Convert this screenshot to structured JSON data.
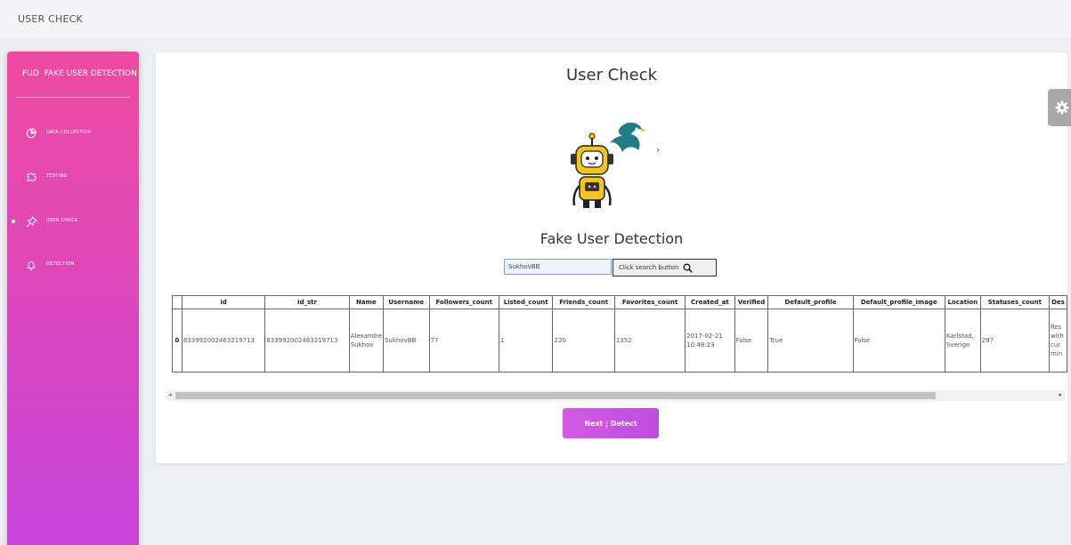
{
  "app": {
    "title": "USER CHECK"
  },
  "sidebar": {
    "brand_abbr": "FUD",
    "brand_name": "FAKE USER DETECTION",
    "items": [
      {
        "label": "DATA COLLECTION",
        "icon": "pie-chart-icon",
        "active": false
      },
      {
        "label": "TESTING",
        "icon": "puzzle-icon",
        "active": false
      },
      {
        "label": "USER CHECK",
        "icon": "pin-icon",
        "active": true
      },
      {
        "label": "DETECTION",
        "icon": "bell-icon",
        "active": false
      }
    ]
  },
  "main": {
    "title": "User Check",
    "subtitle": "Fake User Detection",
    "search": {
      "value": "SukhovBB",
      "button_label": "Click search button"
    },
    "next_button": "Next | Detect"
  },
  "table": {
    "columns": [
      "",
      "id",
      "id_str",
      "Name",
      "Username",
      "Followers_count",
      "Listed_count",
      "Friends_count",
      "Favorites_count",
      "Created_at",
      "Verified",
      "Default_profile",
      "Default_profile_image",
      "Location",
      "Statuses_count",
      "Des"
    ],
    "rows": [
      [
        "0",
        "833992002463219713",
        "833992002463219713",
        "Alexandre Sukhov",
        "SukhovBB",
        "77",
        "1",
        "220",
        "1352",
        "2017-02-21 10:48:23",
        "False",
        "True",
        "False",
        "Karlstad, Sverige",
        "297",
        "Res with cur min"
      ]
    ]
  },
  "colors": {
    "sidebar_top": "#ef4aa0",
    "sidebar_bottom": "#c844dc",
    "accent": "#c04ce0"
  }
}
